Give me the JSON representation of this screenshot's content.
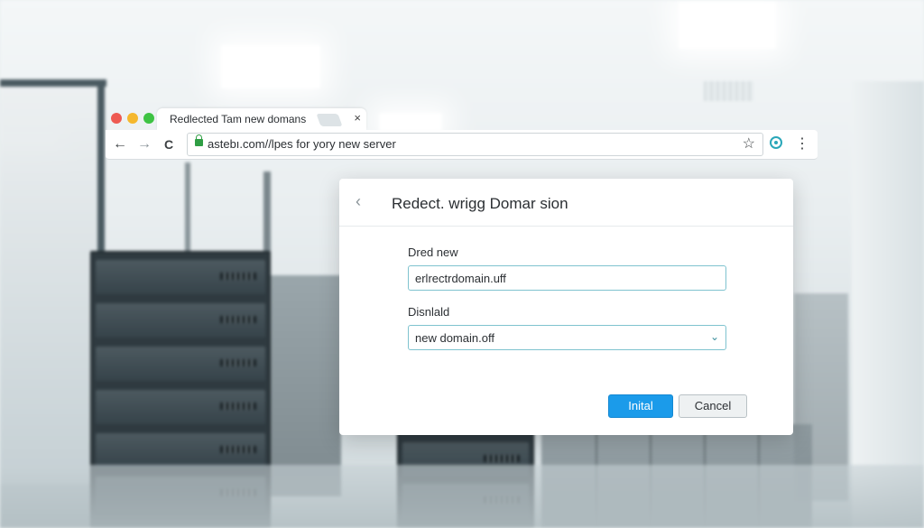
{
  "browser": {
    "tab": {
      "title": "Redlected Tam new domans",
      "close_symbol": "×"
    },
    "toolbar": {
      "back_symbol": "←",
      "forward_symbol": "→",
      "reload_symbol": "C",
      "url": "astebı.com//lpes for yory new server",
      "star_symbol": "☆",
      "menu_symbol": "⋮"
    },
    "window_controls": {
      "close": "#ee5a52",
      "minimize": "#f5b82e",
      "maximize": "#3ec343"
    }
  },
  "dialog": {
    "back_symbol": "‹",
    "title": "Redect. wrigg Domar sion",
    "field1": {
      "label": "Dred new",
      "value": "erlrectrdomain.uff"
    },
    "field2": {
      "label": "Disnlald",
      "value": "new domain.off",
      "chevron": "⌄"
    },
    "primary_button": "Inital",
    "secondary_button": "Cancel"
  },
  "icons": {
    "lock": "lock-icon",
    "extension": "extension-icon",
    "star": "bookmark-star-icon"
  },
  "colors": {
    "accent": "#1b9bea",
    "field_border": "#7fc3cf",
    "secure_green": "#2f9e44"
  }
}
